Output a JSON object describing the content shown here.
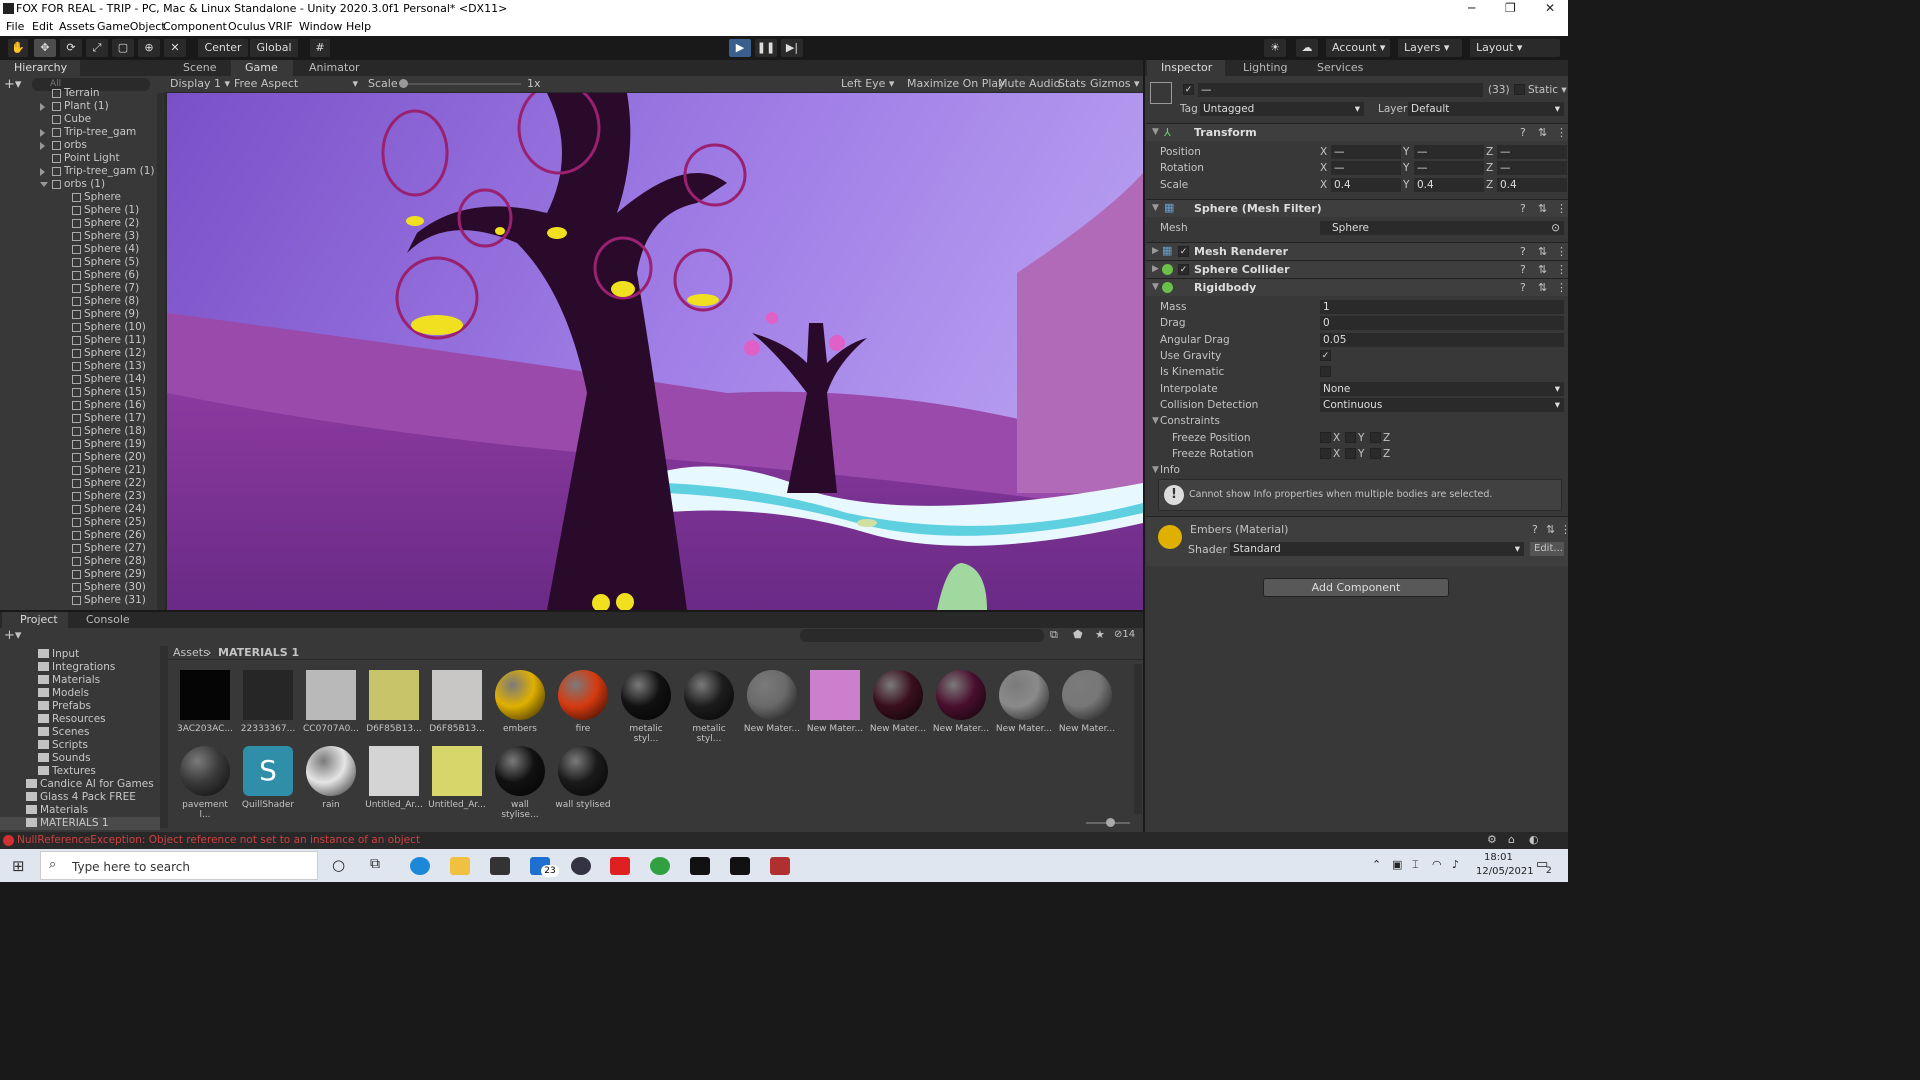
{
  "window": {
    "title": "FOX FOR REAL - TRIP - PC, Mac & Linux Standalone - Unity 2020.3.0f1 Personal* <DX11>"
  },
  "menu": [
    "File",
    "Edit",
    "Assets",
    "GameObject",
    "Component",
    "Oculus",
    "VRIF",
    "Window",
    "Help"
  ],
  "toolbar": {
    "pivot": "Center",
    "space": "Global",
    "account": "Account",
    "layers": "Layers",
    "layout": "Layout"
  },
  "hierarchy": {
    "tab": "Hierarchy",
    "search_placeholder": "All",
    "items": [
      {
        "label": "Terrain",
        "indent": 1,
        "arrow": "none"
      },
      {
        "label": "Plant (1)",
        "indent": 1,
        "arrow": "closed"
      },
      {
        "label": "Cube",
        "indent": 1,
        "arrow": "none"
      },
      {
        "label": "Trip-tree_gam",
        "indent": 1,
        "arrow": "closed"
      },
      {
        "label": "orbs",
        "indent": 1,
        "arrow": "closed"
      },
      {
        "label": "Point Light",
        "indent": 1,
        "arrow": "none"
      },
      {
        "label": "Trip-tree_gam (1)",
        "indent": 1,
        "arrow": "closed"
      },
      {
        "label": "orbs (1)",
        "indent": 1,
        "arrow": "open"
      },
      {
        "label": "Sphere",
        "indent": 2,
        "arrow": "none"
      },
      {
        "label": "Sphere (1)",
        "indent": 2,
        "arrow": "none"
      },
      {
        "label": "Sphere (2)",
        "indent": 2,
        "arrow": "none"
      },
      {
        "label": "Sphere (3)",
        "indent": 2,
        "arrow": "none"
      },
      {
        "label": "Sphere (4)",
        "indent": 2,
        "arrow": "none"
      },
      {
        "label": "Sphere (5)",
        "indent": 2,
        "arrow": "none"
      },
      {
        "label": "Sphere (6)",
        "indent": 2,
        "arrow": "none"
      },
      {
        "label": "Sphere (7)",
        "indent": 2,
        "arrow": "none"
      },
      {
        "label": "Sphere (8)",
        "indent": 2,
        "arrow": "none"
      },
      {
        "label": "Sphere (9)",
        "indent": 2,
        "arrow": "none"
      },
      {
        "label": "Sphere (10)",
        "indent": 2,
        "arrow": "none"
      },
      {
        "label": "Sphere (11)",
        "indent": 2,
        "arrow": "none"
      },
      {
        "label": "Sphere (12)",
        "indent": 2,
        "arrow": "none"
      },
      {
        "label": "Sphere (13)",
        "indent": 2,
        "arrow": "none"
      },
      {
        "label": "Sphere (14)",
        "indent": 2,
        "arrow": "none"
      },
      {
        "label": "Sphere (15)",
        "indent": 2,
        "arrow": "none"
      },
      {
        "label": "Sphere (16)",
        "indent": 2,
        "arrow": "none"
      },
      {
        "label": "Sphere (17)",
        "indent": 2,
        "arrow": "none"
      },
      {
        "label": "Sphere (18)",
        "indent": 2,
        "arrow": "none"
      },
      {
        "label": "Sphere (19)",
        "indent": 2,
        "arrow": "none"
      },
      {
        "label": "Sphere (20)",
        "indent": 2,
        "arrow": "none"
      },
      {
        "label": "Sphere (21)",
        "indent": 2,
        "arrow": "none"
      },
      {
        "label": "Sphere (22)",
        "indent": 2,
        "arrow": "none"
      },
      {
        "label": "Sphere (23)",
        "indent": 2,
        "arrow": "none"
      },
      {
        "label": "Sphere (24)",
        "indent": 2,
        "arrow": "none"
      },
      {
        "label": "Sphere (25)",
        "indent": 2,
        "arrow": "none"
      },
      {
        "label": "Sphere (26)",
        "indent": 2,
        "arrow": "none"
      },
      {
        "label": "Sphere (27)",
        "indent": 2,
        "arrow": "none"
      },
      {
        "label": "Sphere (28)",
        "indent": 2,
        "arrow": "none"
      },
      {
        "label": "Sphere (29)",
        "indent": 2,
        "arrow": "none"
      },
      {
        "label": "Sphere (30)",
        "indent": 2,
        "arrow": "none"
      },
      {
        "label": "Sphere (31)",
        "indent": 2,
        "arrow": "none"
      }
    ]
  },
  "view_tabs": {
    "scene": "Scene",
    "game": "Game",
    "animator": "Animator"
  },
  "game_bar": {
    "display": "Display 1",
    "aspect": "Free Aspect",
    "scale_label": "Scale",
    "scale_value": "1x",
    "eye": "Left Eye",
    "maximize": "Maximize On Play",
    "mute": "Mute Audio",
    "stats": "Stats",
    "gizmos": "Gizmos"
  },
  "inspector": {
    "tabs": {
      "inspector": "Inspector",
      "lighting": "Lighting",
      "services": "Services"
    },
    "header": {
      "count": "(33)",
      "static": "Static",
      "name": "—",
      "tag_label": "Tag",
      "tag": "Untagged",
      "layer_label": "Layer",
      "layer": "Default"
    },
    "transform": {
      "title": "Transform",
      "position": "Position",
      "rotation": "Rotation",
      "scale": "Scale",
      "x": "X",
      "y": "Y",
      "z": "Z",
      "dash": "—",
      "scale_x": "0.4",
      "scale_y": "0.4",
      "scale_z": "0.4"
    },
    "mesh_filter": {
      "title": "Sphere (Mesh Filter)",
      "mesh_label": "Mesh",
      "mesh_value": "Sphere"
    },
    "mesh_renderer": {
      "title": "Mesh Renderer"
    },
    "sphere_collider": {
      "title": "Sphere Collider"
    },
    "rigidbody": {
      "title": "Rigidbody",
      "mass_label": "Mass",
      "mass": "1",
      "drag_label": "Drag",
      "drag": "0",
      "angular_label": "Angular Drag",
      "angular": "0.05",
      "gravity_label": "Use Gravity",
      "kinematic_label": "Is Kinematic",
      "interp_label": "Interpolate",
      "interp": "None",
      "collision_label": "Collision Detection",
      "collision": "Continuous",
      "constraints": "Constraints",
      "freeze_pos": "Freeze Position",
      "freeze_rot": "Freeze Rotation",
      "info": "Info",
      "info_msg": "Cannot show Info properties when multiple bodies are selected."
    },
    "material": {
      "title": "Embers (Material)",
      "shader_label": "Shader",
      "shader": "Standard",
      "edit": "Edit..."
    },
    "add_component": "Add Component"
  },
  "project": {
    "tabs": {
      "project": "Project",
      "console": "Console"
    },
    "hidden_count": "14",
    "breadcrumb": [
      "Assets",
      "MATERIALS 1"
    ],
    "folders": [
      {
        "label": "Input",
        "indent": 1
      },
      {
        "label": "Integrations",
        "indent": 1
      },
      {
        "label": "Materials",
        "indent": 1
      },
      {
        "label": "Models",
        "indent": 1
      },
      {
        "label": "Prefabs",
        "indent": 1
      },
      {
        "label": "Resources",
        "indent": 1
      },
      {
        "label": "Scenes",
        "indent": 1
      },
      {
        "label": "Scripts",
        "indent": 1
      },
      {
        "label": "Sounds",
        "indent": 1
      },
      {
        "label": "Textures",
        "indent": 1
      },
      {
        "label": "Candice AI for Games",
        "indent": 0
      },
      {
        "label": "Glass 4 Pack FREE",
        "indent": 0
      },
      {
        "label": "Materials",
        "indent": 0
      },
      {
        "label": "MATERIALS 1",
        "indent": 0
      }
    ],
    "assets": [
      {
        "name": "3AC203AC...",
        "color": "#050505",
        "shape": "square"
      },
      {
        "name": "22333367...",
        "color": "#262626",
        "shape": "square"
      },
      {
        "name": "CC0707A0...",
        "color": "#b9b9b9",
        "shape": "square"
      },
      {
        "name": "D6F85B13...",
        "color": "#c7c46a",
        "shape": "square"
      },
      {
        "name": "D6F85B13...",
        "color": "#c9c6c6",
        "shape": "square"
      },
      {
        "name": "embers",
        "color": "#e0b000",
        "shape": "sphere"
      },
      {
        "name": "fire",
        "color": "#d63a10",
        "shape": "sphere"
      },
      {
        "name": "metalic styl...",
        "color": "#111111",
        "shape": "sphere"
      },
      {
        "name": "metalic styl...",
        "color": "#1c1c1c",
        "shape": "sphere"
      },
      {
        "name": "New Mater...",
        "color": "#6a6a6a",
        "shape": "sphere"
      },
      {
        "name": "New Mater...",
        "color": "#cc7fcc",
        "shape": "square"
      },
      {
        "name": "New Mater...",
        "color": "#3a0f1e",
        "shape": "sphere"
      },
      {
        "name": "New Mater...",
        "color": "#4a0f2e",
        "shape": "sphere"
      },
      {
        "name": "New Mater...",
        "color": "#8a8a8a",
        "shape": "sphere"
      },
      {
        "name": "New Mater...",
        "color": "#777777",
        "shape": "sphere"
      },
      {
        "name": "pavement l...",
        "color": "#3a3a3a",
        "shape": "sphere"
      },
      {
        "name": "QuillShader",
        "color": "#2f8fa8",
        "shape": "shader"
      },
      {
        "name": "rain",
        "color": "#e5e5e5",
        "shape": "sphere"
      },
      {
        "name": "Untitled_Ar...",
        "color": "#d4d4d4",
        "shape": "square"
      },
      {
        "name": "Untitled_Ar...",
        "color": "#d6d66a",
        "shape": "square"
      },
      {
        "name": "wall stylise...",
        "color": "#111111",
        "shape": "sphere"
      },
      {
        "name": "wall stylised",
        "color": "#1a1a1a",
        "shape": "sphere"
      }
    ]
  },
  "status": {
    "error": "NullReferenceException: Object reference not set to an instance of an object"
  },
  "taskbar": {
    "search_placeholder": "Type here to search",
    "time": "18:01",
    "date": "12/05/2021",
    "mail_badge": "23",
    "notif": "2"
  }
}
